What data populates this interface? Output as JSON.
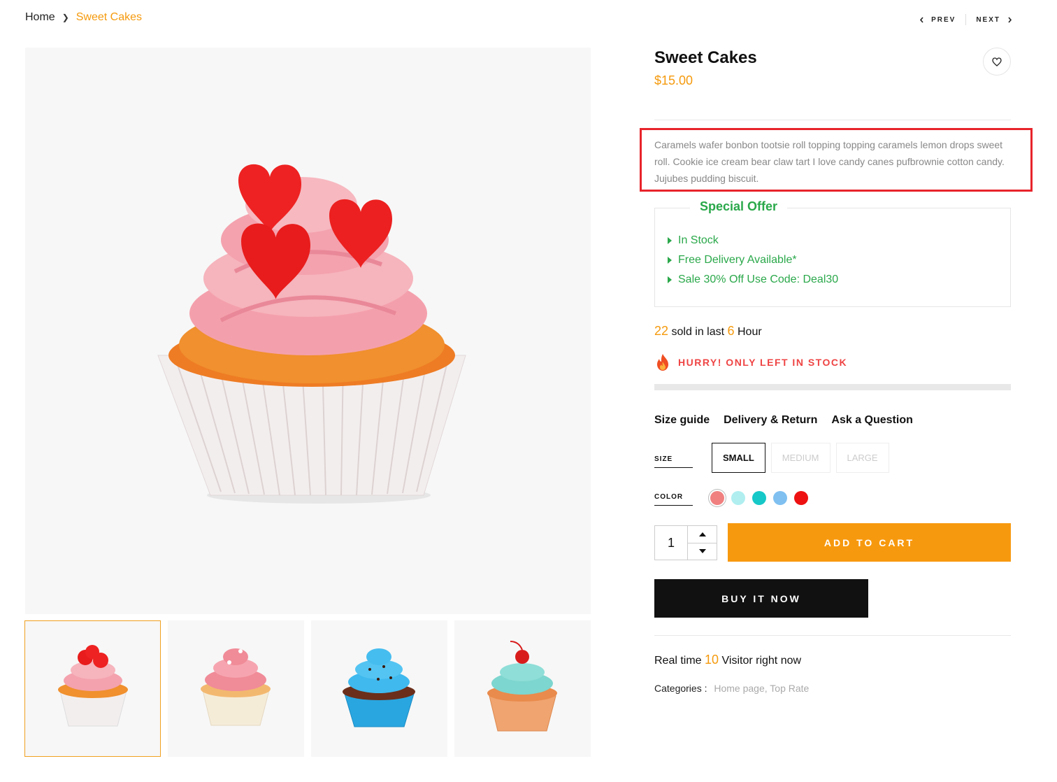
{
  "breadcrumb": {
    "home": "Home",
    "current": "Sweet Cakes"
  },
  "pager": {
    "prev": "PREV",
    "next": "NEXT"
  },
  "product": {
    "title": "Sweet Cakes",
    "price": "$15.00",
    "description": "Caramels wafer bonbon tootsie roll topping topping caramels lemon drops sweet roll. Cookie ice cream bear claw tart I love candy canes pufbrownie cotton candy. Jujubes pudding biscuit."
  },
  "offer": {
    "title": "Special Offer",
    "items": [
      "In Stock",
      "Free Delivery Available*",
      "Sale 30% Off Use Code: Deal30"
    ]
  },
  "sold": {
    "count": "22",
    "mid": "sold in last",
    "hours": "6",
    "unit": "Hour"
  },
  "hurry": "HURRY! ONLY LEFT IN STOCK",
  "links": [
    "Size guide",
    "Delivery & Return",
    "Ask a Question"
  ],
  "options": {
    "size_label": "SIZE",
    "sizes": [
      "SMALL",
      "MEDIUM",
      "LARGE"
    ],
    "selected_size": "SMALL",
    "color_label": "COLOR",
    "colors": [
      "#f08080",
      "#b0eef0",
      "#16c8c8",
      "#7fc0f0",
      "#ee1111"
    ]
  },
  "quantity": "1",
  "buttons": {
    "add_to_cart": "ADD TO CART",
    "buy_now": "BUY IT NOW"
  },
  "visitors": {
    "prefix": "Real time",
    "count": "10",
    "suffix": "Visitor right now"
  },
  "categories": {
    "label": "Categories :",
    "values": "Home page, Top Rate"
  },
  "colors": {
    "accent": "#f59a0d",
    "green": "#2aa84a",
    "hurry": "#ef4444",
    "highlight": "#e8242b"
  }
}
